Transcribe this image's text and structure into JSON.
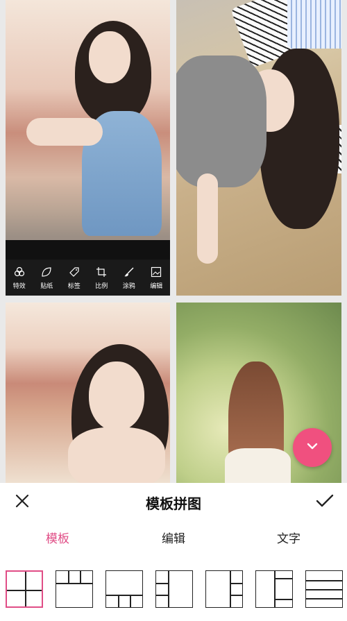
{
  "colors": {
    "accent": "#e04d86",
    "fab": "#f0507f",
    "toolbar_bg": "#1a1a1a"
  },
  "photo_tools": [
    {
      "label": "特效",
      "icon": "effects-icon"
    },
    {
      "label": "贴纸",
      "icon": "sticker-icon"
    },
    {
      "label": "标签",
      "icon": "tag-icon"
    },
    {
      "label": "比例",
      "icon": "crop-ratio-icon"
    },
    {
      "label": "涂鸦",
      "icon": "brush-icon"
    },
    {
      "label": "编辑",
      "icon": "edit-image-icon"
    }
  ],
  "fab": {
    "icon": "chevron-down-icon"
  },
  "header": {
    "title": "模板拼图",
    "close_icon": "close-icon",
    "confirm_icon": "checkmark-icon"
  },
  "tabs": [
    {
      "label": "模板",
      "active": true
    },
    {
      "label": "编辑",
      "active": false
    },
    {
      "label": "文字",
      "active": false
    }
  ],
  "layout_templates": {
    "selected_index": 0,
    "count": 7
  }
}
